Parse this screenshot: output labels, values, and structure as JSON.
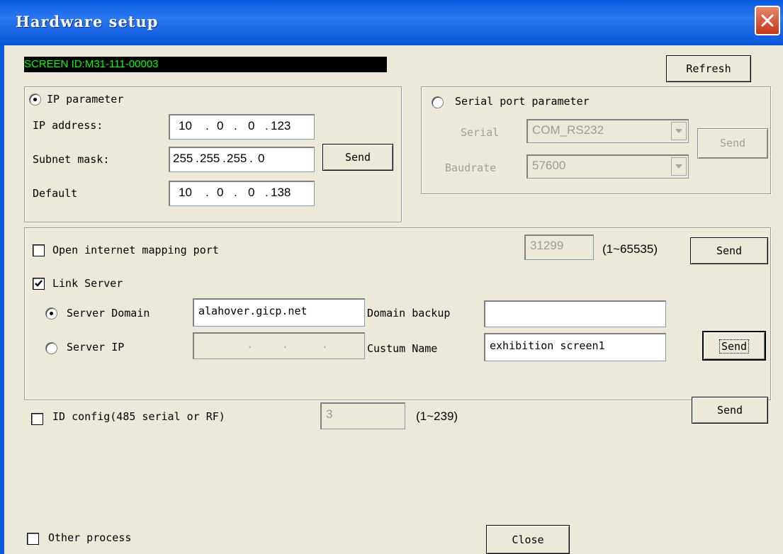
{
  "window": {
    "title": "Hardware setup"
  },
  "screen_id": "SCREEN ID:M31-111-00003",
  "buttons": {
    "refresh": "Refresh",
    "ip_send": "Send",
    "serial_send": "Send",
    "mapping_send": "Send",
    "server_send": "Send",
    "id_send": "Send",
    "close": "Close"
  },
  "ip_parameter": {
    "label": "IP parameter",
    "selected": true,
    "ip_label": "IP address:",
    "ip_value": [
      "10",
      "0",
      "0",
      "123"
    ],
    "subnet_label": "Subnet mask:",
    "subnet_value": [
      "255",
      "255",
      "255",
      "0"
    ],
    "default_label": "Default",
    "default_value": [
      "10",
      "0",
      "0",
      "138"
    ]
  },
  "serial_parameter": {
    "label": "Serial port parameter",
    "selected": false,
    "serial_label": "Serial",
    "serial_value": "COM_RS232",
    "baudrate_label": "Baudrate",
    "baudrate_value": "57600"
  },
  "mapping": {
    "label": "Open internet mapping port",
    "checked": false,
    "port_value": "31299",
    "range": "(1~65535)"
  },
  "link_server": {
    "label": "Link Server",
    "checked": true,
    "domain_radio_label": "Server Domain",
    "domain_value": "alahover.gicp.net",
    "ip_radio_label": "Server IP",
    "domain_backup_label": "Domain backup",
    "domain_backup_value": "",
    "custom_name_label": "Custum Name",
    "custom_name_value": "exhibition screen1"
  },
  "id_config": {
    "label": "ID config(485 serial or RF)",
    "checked": false,
    "value": "3",
    "range": "(1~239)"
  },
  "other_process": {
    "label": "Other process",
    "checked": false
  },
  "colors": {
    "title_bar": "#0A5BE0",
    "dialog_bg": "#ECE9D8",
    "screen_id_text": "#00FF00"
  }
}
